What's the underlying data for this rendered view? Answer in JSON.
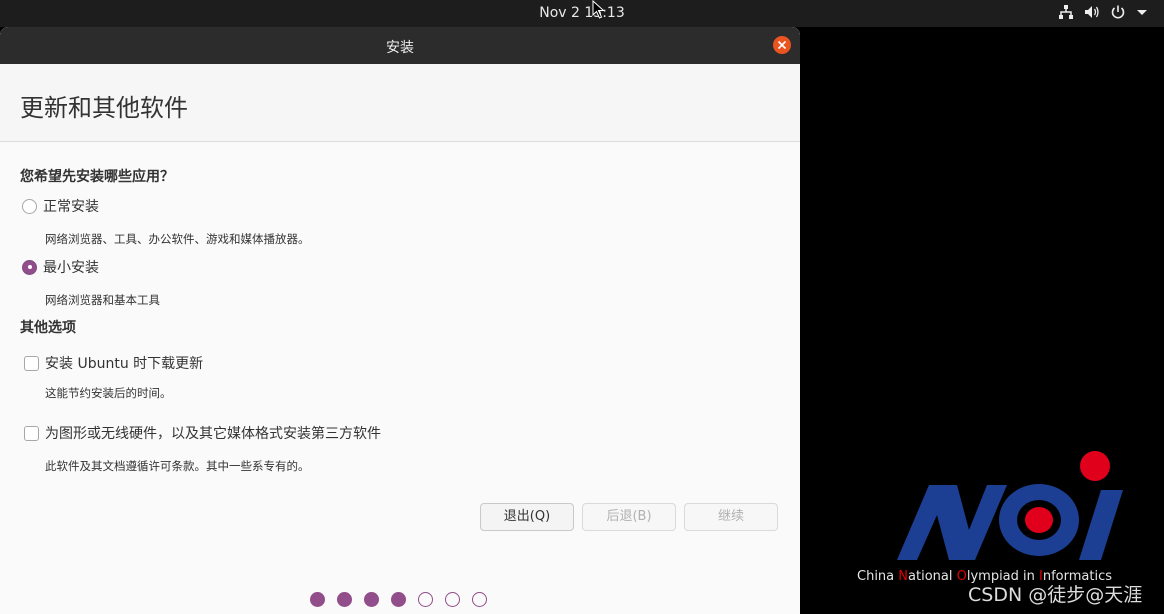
{
  "topbar": {
    "clock": "Nov 2  15:13",
    "icons": [
      "network-icon",
      "volume-icon",
      "power-icon",
      "chevron-down-icon"
    ]
  },
  "window": {
    "title": "安装",
    "page_title": "更新和其他软件",
    "question": "您希望先安装哪些应用？",
    "options": [
      {
        "label": "正常安装",
        "desc": "网络浏览器、工具、办公软件、游戏和媒体播放器。",
        "selected": false
      },
      {
        "label": "最小安装",
        "desc": "网络浏览器和基本工具",
        "selected": true
      }
    ],
    "other_title": "其他选项",
    "checks": [
      {
        "label": "安装 Ubuntu 时下载更新",
        "desc": "这能节约安装后的时间。",
        "checked": false
      },
      {
        "label": "为图形或无线硬件，以及其它媒体格式安装第三方软件",
        "desc": "此软件及其文档遵循许可条款。其中一些系专有的。",
        "checked": false
      }
    ],
    "buttons": {
      "quit": "退出(Q)",
      "back": "后退(B)",
      "continue": "继续"
    },
    "progress": {
      "steps_done": 4,
      "steps_total": 7
    }
  },
  "wallpaper": {
    "logo_text_parts": [
      "China ",
      "N",
      "ational ",
      "O",
      "lympiad in ",
      "I",
      "nformatics"
    ],
    "watermark": "CSDN @徒步@天涯"
  },
  "colors": {
    "accent": "#924d8b",
    "close": "#e95420",
    "logo_blue": "#1c3f94",
    "logo_red": "#e0001b"
  }
}
